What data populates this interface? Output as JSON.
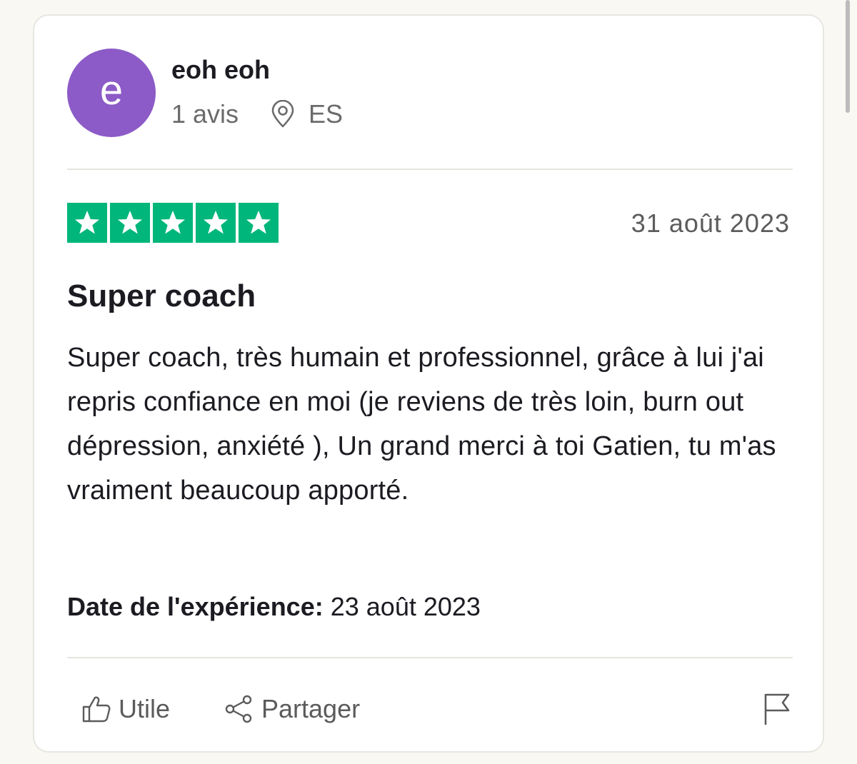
{
  "reviewer": {
    "avatar_letter": "e",
    "avatar_color": "#8c5bc7",
    "name": "eoh eoh",
    "review_count": "1 avis",
    "location_icon": "map-pin-icon",
    "country": "ES"
  },
  "review": {
    "rating": 5,
    "rating_max": 5,
    "star_color": "#00b67a",
    "date": "31 août 2023",
    "title": "Super coach",
    "body": "Super coach, très humain et professionnel, grâce à lui j'ai repris confiance en moi (je reviens de très loin, burn out dépression, anxiété ), Un grand merci à toi Gatien, tu m'as vraiment beaucoup apporté.",
    "experience_label": "Date de l'expérience:",
    "experience_date": "23 août 2023"
  },
  "actions": {
    "useful_label": "Utile",
    "useful_icon": "thumbs-up-icon",
    "share_label": "Partager",
    "share_icon": "share-icon",
    "report_icon": "flag-icon"
  }
}
